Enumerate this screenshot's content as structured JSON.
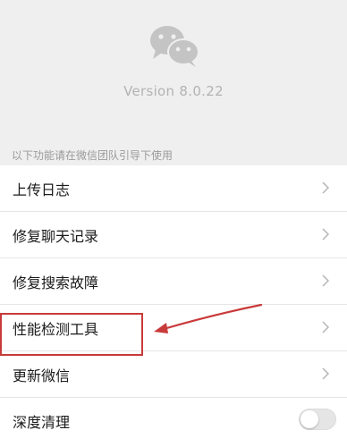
{
  "header": {
    "app_icon": "wechat-logo-icon",
    "version": "Version 8.0.22",
    "hint": "以下功能请在微信团队引导下使用"
  },
  "menu": {
    "items": [
      {
        "label": "上传日志",
        "control": "chevron-right-icon"
      },
      {
        "label": "修复聊天记录",
        "control": "chevron-right-icon"
      },
      {
        "label": "修复搜索故障",
        "control": "chevron-right-icon"
      },
      {
        "label": "性能检测工具",
        "control": "chevron-right-icon",
        "highlighted": true
      },
      {
        "label": "更新微信",
        "control": "chevron-right-icon"
      },
      {
        "label": "深度清理",
        "control": "toggle-switch",
        "toggle_on": false
      }
    ]
  },
  "annotation": {
    "highlight_color": "#c93a3a",
    "arrow_color": "#c93a3a"
  },
  "colors": {
    "header_bg": "#efefef",
    "logo_color": "#c4c4c4"
  }
}
